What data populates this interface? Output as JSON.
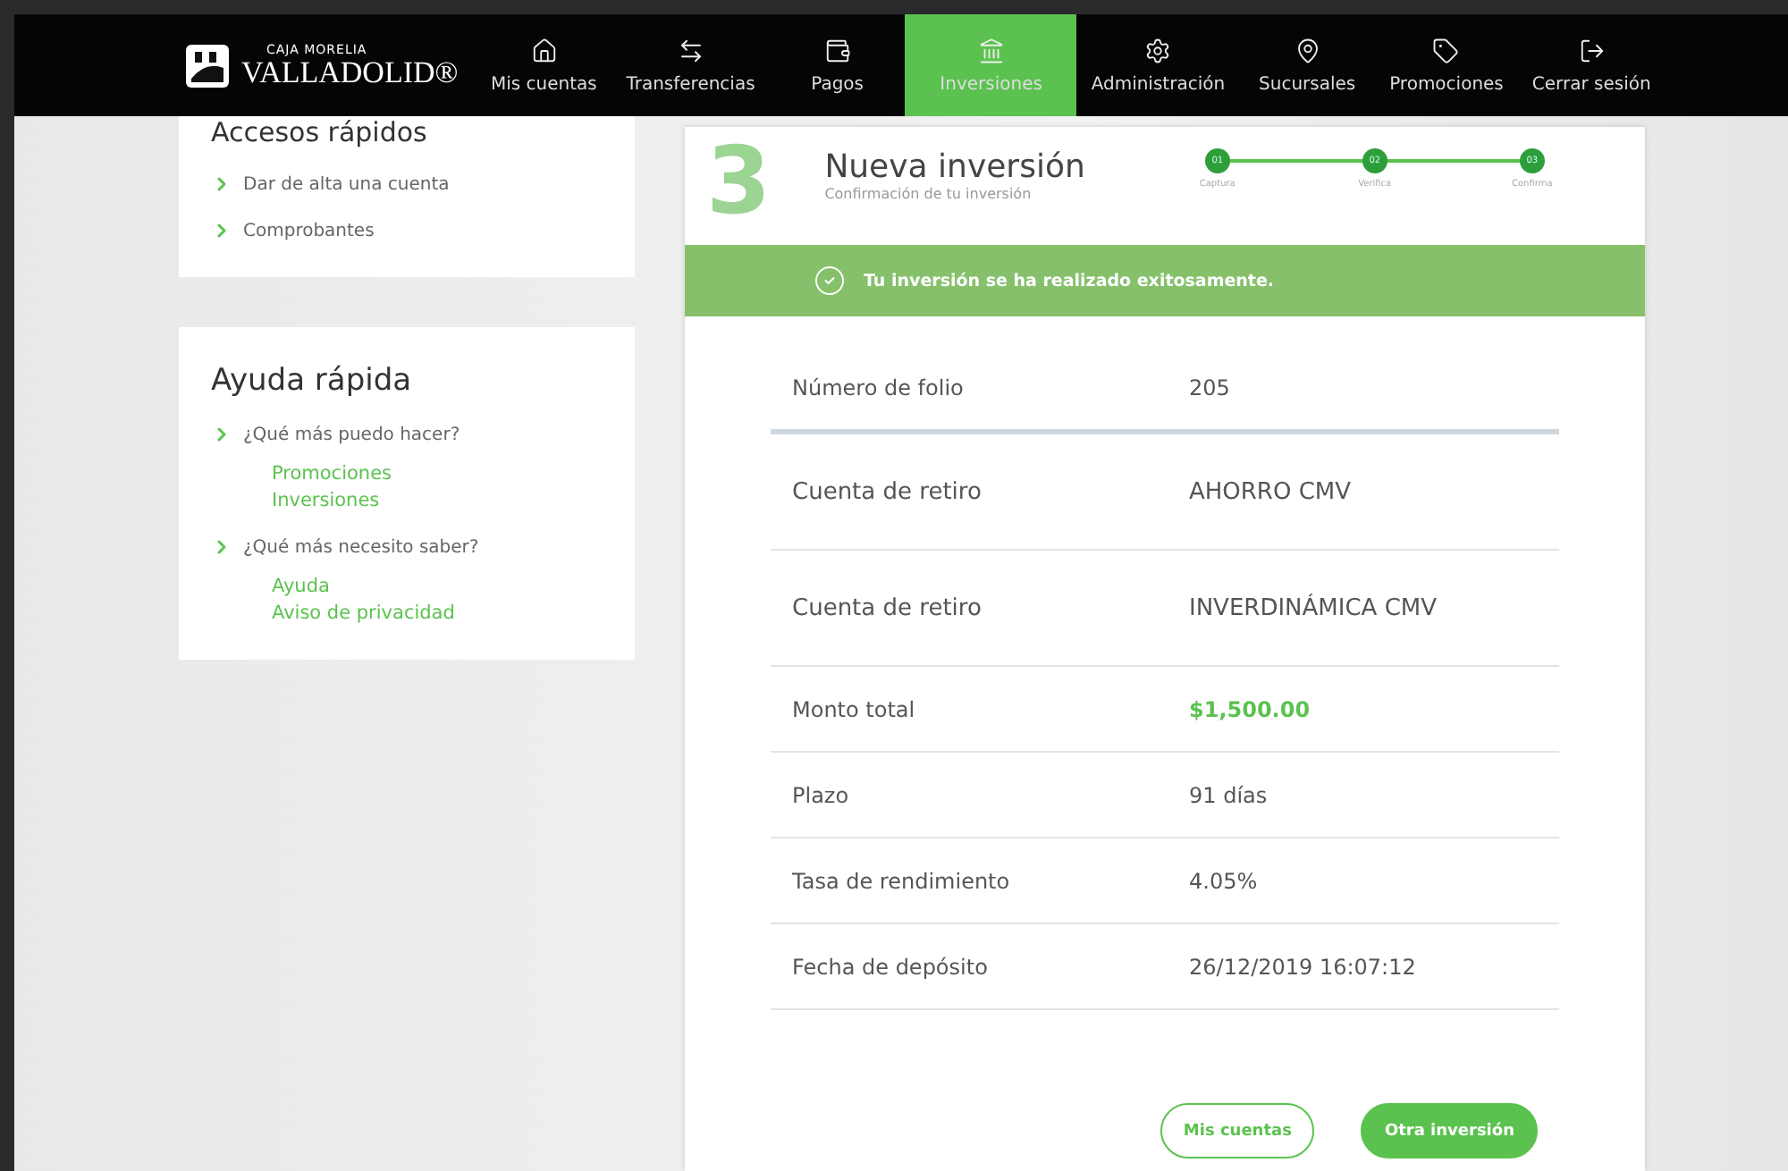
{
  "brand": {
    "line1": "CAJA MORELIA",
    "line2": "VALLADOLID®"
  },
  "nav": [
    {
      "label": "Mis cuentas",
      "selected": false
    },
    {
      "label": "Transferencias",
      "selected": false
    },
    {
      "label": "Pagos",
      "selected": false
    },
    {
      "label": "Inversiones",
      "selected": true
    },
    {
      "label": "Administración",
      "selected": false
    },
    {
      "label": "Sucursales",
      "selected": false
    },
    {
      "label": "Promociones",
      "selected": false
    },
    {
      "label": "Cerrar sesión",
      "selected": false
    }
  ],
  "quick_access": {
    "title": "Accesos rápidos",
    "items": [
      "Dar de alta una cuenta",
      "Comprobantes"
    ]
  },
  "quick_help": {
    "title": "Ayuda rápida",
    "groups": [
      {
        "label": "¿Qué más puedo hacer?",
        "links": [
          "Promociones",
          "Inversiones"
        ]
      },
      {
        "label": "¿Qué más necesito saber?",
        "links": [
          "Ayuda",
          "Aviso de privacidad"
        ]
      }
    ]
  },
  "card": {
    "step_number": "3",
    "title": "Nueva inversión",
    "subtitle": "Confirmación de tu inversión",
    "steps": [
      {
        "num": "01",
        "label": "Captura",
        "done": true
      },
      {
        "num": "02",
        "label": "Verifica",
        "done": true
      },
      {
        "num": "03",
        "label": "Confirma",
        "done": true
      }
    ],
    "banner": "Tu inversión se ha realizado exitosamente.",
    "rows": [
      {
        "label": "Número de folio",
        "value": "205",
        "kind": "detail",
        "highlight": false
      },
      {
        "label": "Cuenta de retiro",
        "value": "AHORRO CMV",
        "kind": "account",
        "highlight": false
      },
      {
        "label": "Cuenta de retiro",
        "value": "INVERDINÁMICA CMV",
        "kind": "account",
        "highlight": false
      },
      {
        "label": "Monto total",
        "value": "$1,500.00",
        "kind": "detail",
        "highlight": true
      },
      {
        "label": "Plazo",
        "value": "91 días",
        "kind": "detail",
        "highlight": false
      },
      {
        "label": "Tasa de rendimiento",
        "value": "4.05%",
        "kind": "detail",
        "highlight": false
      },
      {
        "label": "Fecha de depósito",
        "value": "26/12/2019 16:07:12",
        "kind": "detail",
        "highlight": false
      }
    ],
    "buttons": [
      {
        "label": "Mis cuentas",
        "kind": "outline"
      },
      {
        "label": "Otra inversión",
        "kind": "primary"
      }
    ]
  }
}
